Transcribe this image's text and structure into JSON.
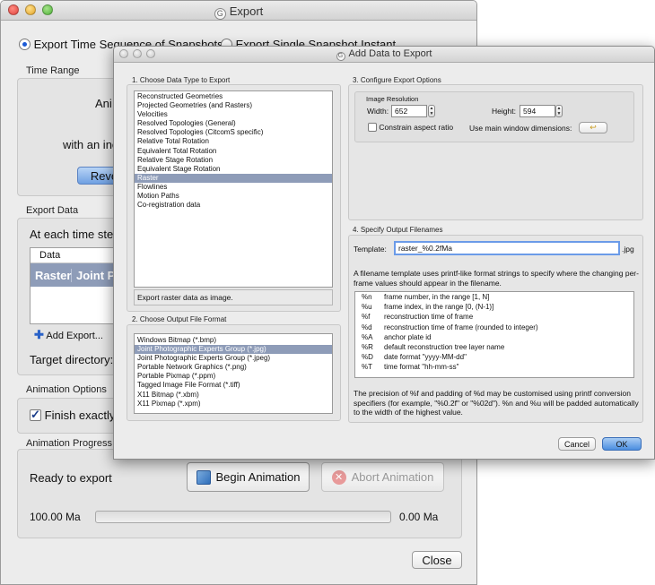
{
  "export_window": {
    "title": "Export",
    "radio_sequence": "Export Time Sequence of Snapshots",
    "radio_single": "Export Single Snapshot Instant",
    "time_range": {
      "label": "Time Range",
      "line1_partial": "Ani",
      "line2_partial": "with an inc",
      "reverse_button": "Reve"
    },
    "export_data": {
      "label": "Export Data",
      "at_each_time": "At each time step",
      "table_header": "Data",
      "row_col1": "Raster",
      "row_col2": "Joint Phot",
      "add_export": "Add Export...",
      "target_directory": "Target directory:"
    },
    "animation_options": {
      "label": "Animation Options",
      "finish_exactly": "Finish exactly"
    },
    "animation_progress": {
      "label": "Animation Progress",
      "status": "Ready to export",
      "begin_button": "Begin Animation",
      "abort_button": "Abort Animation",
      "start_time": "100.00 Ma",
      "end_time": "0.00 Ma",
      "progress": 0
    },
    "close_button": "Close"
  },
  "dialog": {
    "title": "Add Data to Export",
    "section1": {
      "title": "1. Choose Data Type to Export",
      "items": [
        "Reconstructed Geometries",
        "Projected Geometries (and Rasters)",
        "Velocities",
        "Resolved Topologies (General)",
        "Resolved Topologies (CitcomS specific)",
        "Relative Total Rotation",
        "Equivalent Total Rotation",
        "Relative Stage Rotation",
        "Equivalent Stage Rotation",
        "Raster",
        "Flowlines",
        "Motion Paths",
        "Co-registration data"
      ],
      "selected_index": 9,
      "description": "Export raster data as image."
    },
    "section2": {
      "title": "2. Choose Output File Format",
      "items": [
        "Windows Bitmap (*.bmp)",
        "Joint Photographic Experts Group (*.jpg)",
        "Joint Photographic Experts Group (*.jpeg)",
        "Portable Network Graphics (*.png)",
        "Portable Pixmap (*.ppm)",
        "Tagged Image File Format (*.tiff)",
        "X11 Bitmap (*.xbm)",
        "X11 Pixmap (*.xpm)"
      ],
      "selected_index": 1
    },
    "section3": {
      "title": "3. Configure Export Options",
      "image_resolution": "Image Resolution",
      "width_label": "Width:",
      "width_value": "652",
      "height_label": "Height:",
      "height_value": "594",
      "constrain_label": "Constrain aspect ratio",
      "use_main_label": "Use main window dimensions:"
    },
    "section4": {
      "title": "4. Specify Output Filenames",
      "template_label": "Template:",
      "template_value": "raster_%0.2fMa",
      "extension": ".jpg",
      "help_text": "A filename template uses printf-like format strings to specify where the changing per-frame values should appear in the filename.",
      "formats": [
        {
          "code": "%n",
          "desc": "frame number, in the range [1, N]"
        },
        {
          "code": "%u",
          "desc": "frame index, in the range [0, (N-1)]"
        },
        {
          "code": "%f",
          "desc": "reconstruction time of frame"
        },
        {
          "code": "%d",
          "desc": "reconstruction time of frame (rounded to integer)"
        },
        {
          "code": "%A",
          "desc": "anchor plate id"
        },
        {
          "code": "%R",
          "desc": "default reconstruction tree layer name"
        },
        {
          "code": "%D",
          "desc": "date format \"yyyy-MM-dd\""
        },
        {
          "code": "%T",
          "desc": "time format \"hh-mm-ss\""
        }
      ],
      "footer_text": "The precision of %f and padding of %d may be customised using printf conversion specifiers (for example, \"%0.2f\" or \"%02d\"). %n and %u will be padded automatically to the width of the highest value."
    },
    "cancel_button": "Cancel",
    "ok_button": "OK"
  }
}
